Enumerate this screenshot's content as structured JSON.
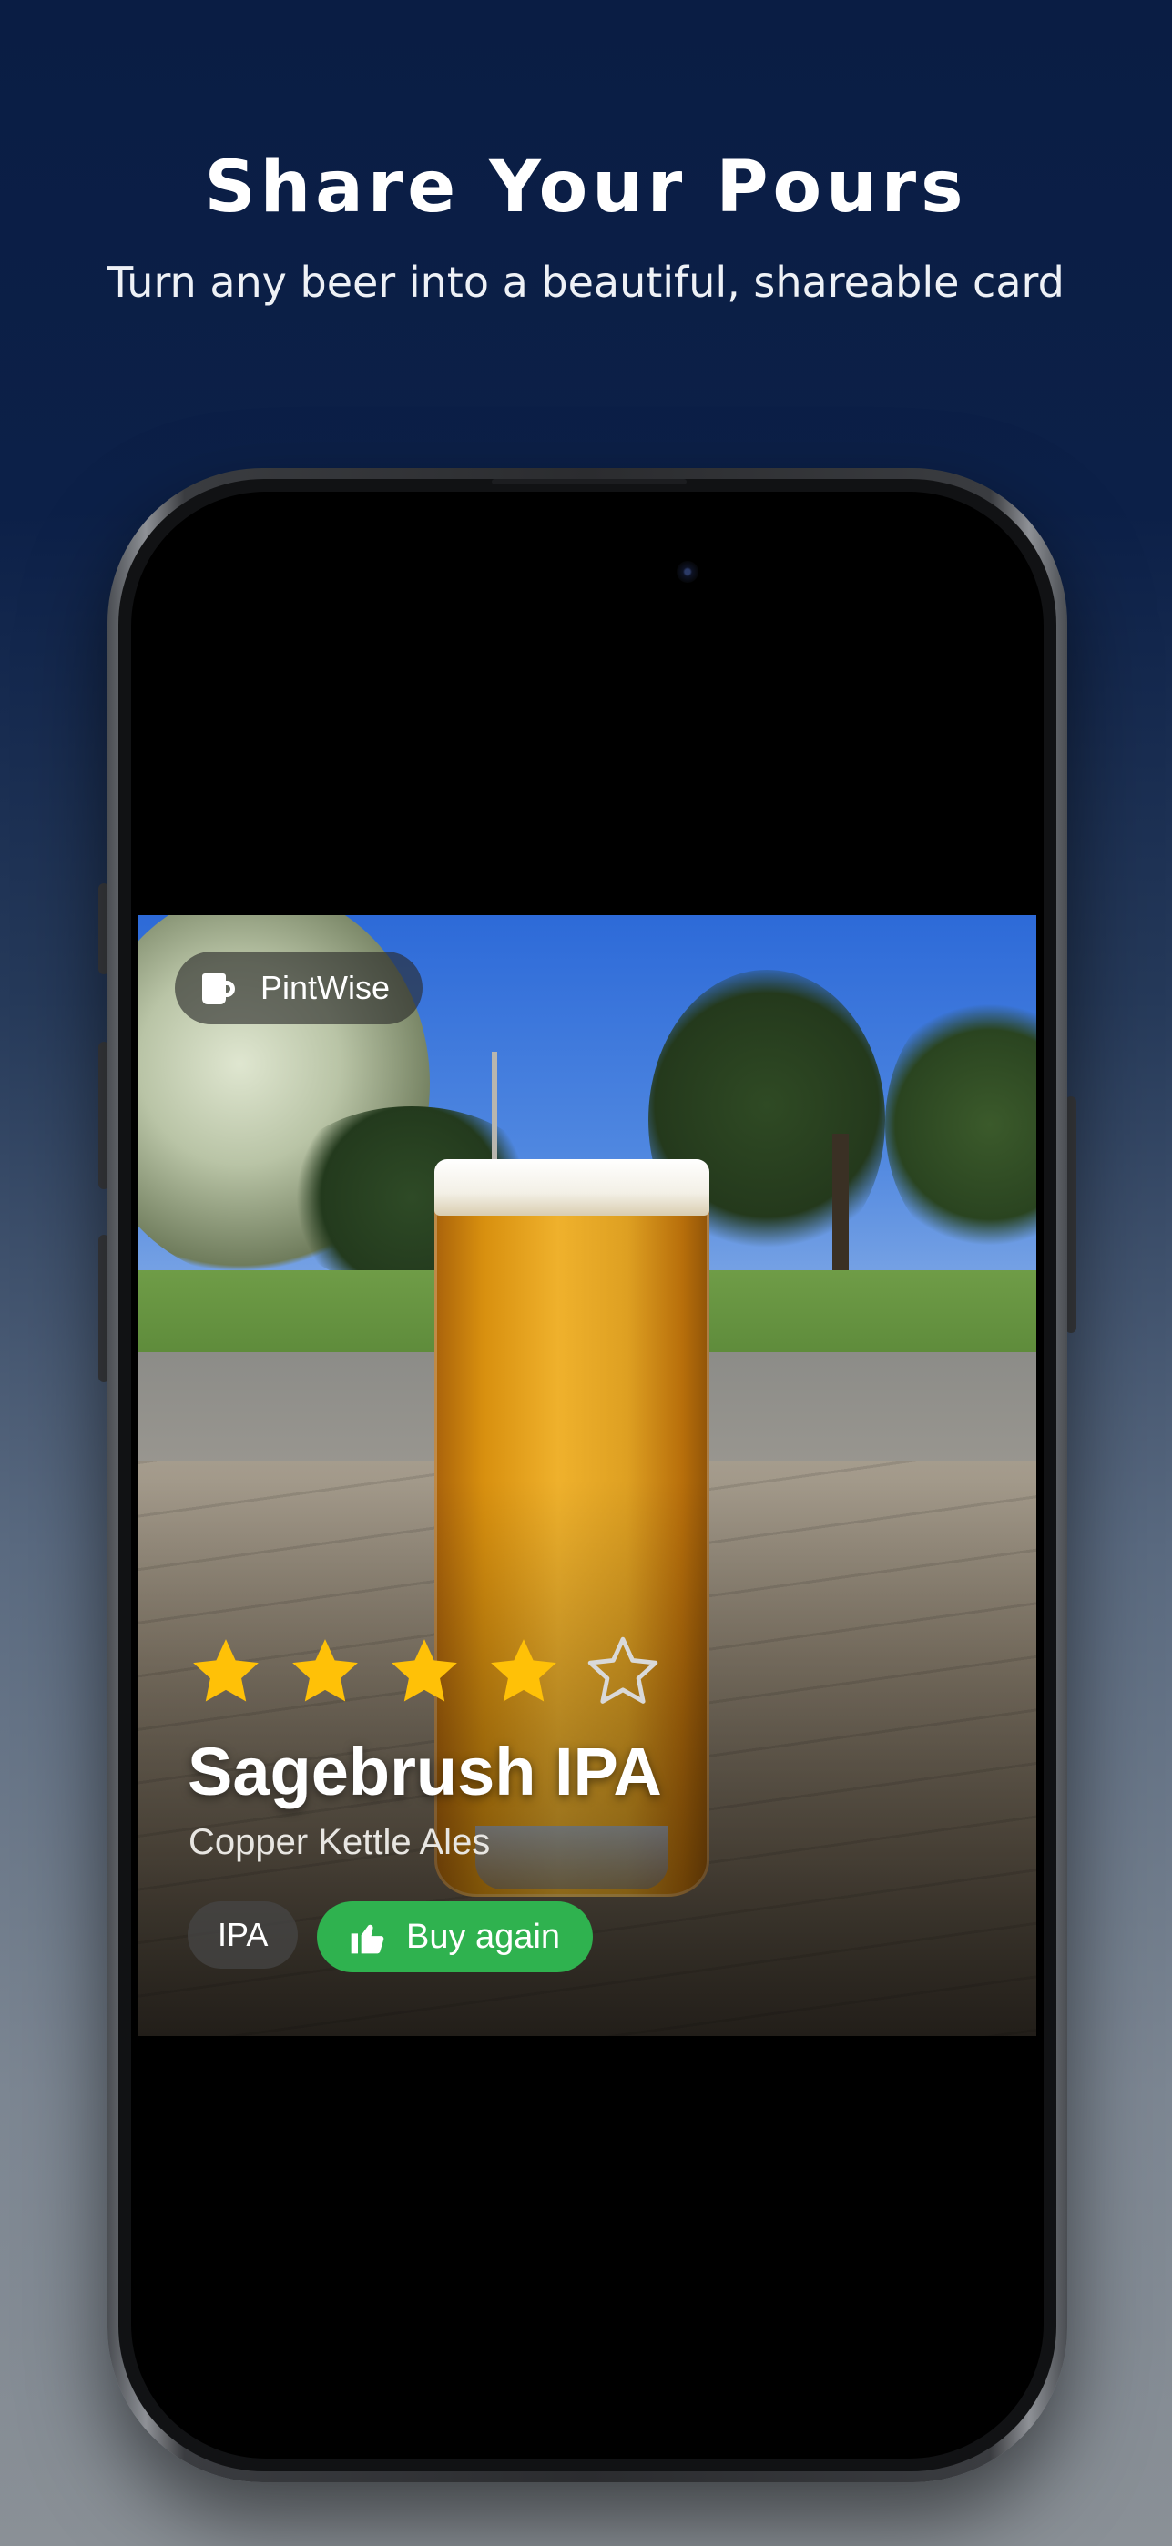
{
  "hero": {
    "title": "Share Your Pours",
    "subtitle": "Turn any beer into a beautiful, shareable card"
  },
  "card": {
    "brand": "PintWise",
    "brand_icon": "beer-mug-icon",
    "rating": 4,
    "rating_max": 5,
    "beer_name": "Sagebrush IPA",
    "brewery": "Copper Kettle Ales",
    "style_tag": "IPA",
    "verdict": "Buy again",
    "verdict_icon": "thumbs-up-icon",
    "colors": {
      "star_filled": "#FFC107",
      "star_empty": "#D9D9D9",
      "verdict_bg": "#2FB24F",
      "background": "#0A1D44"
    }
  }
}
